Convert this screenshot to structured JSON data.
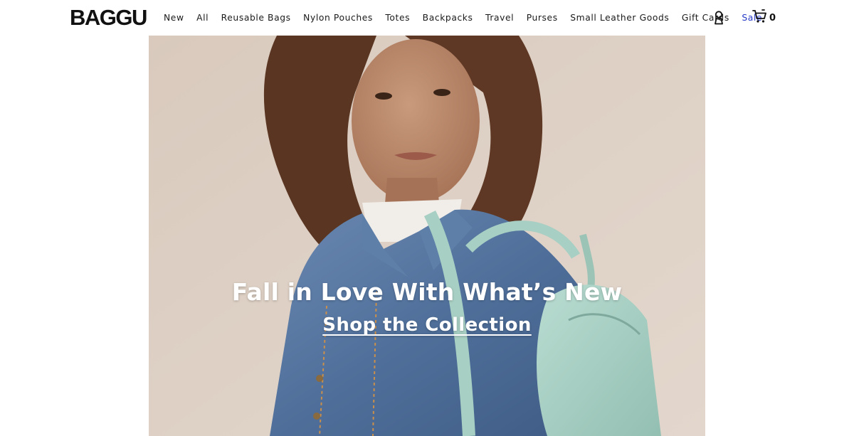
{
  "header": {
    "logo": "BAGGU",
    "nav": [
      {
        "label": "New"
      },
      {
        "label": "All"
      },
      {
        "label": "Reusable Bags"
      },
      {
        "label": "Nylon Pouches"
      },
      {
        "label": "Totes"
      },
      {
        "label": "Backpacks"
      },
      {
        "label": "Travel"
      },
      {
        "label": "Purses"
      },
      {
        "label": "Small Leather Goods"
      },
      {
        "label": "Gift Cards"
      },
      {
        "label": "Sale"
      }
    ],
    "account_icon": "person-icon",
    "cart_icon": "cart-icon",
    "cart_count": "0"
  },
  "hero": {
    "headline": "Fall in Love With What’s New",
    "cta": "Shop the Collection"
  },
  "colors": {
    "sale": "#2639c7",
    "text": "#1a1a1a",
    "hero_bg": "#d8c9bb",
    "denim": "#4f6f9a",
    "backpack": "#a8cfc3"
  }
}
